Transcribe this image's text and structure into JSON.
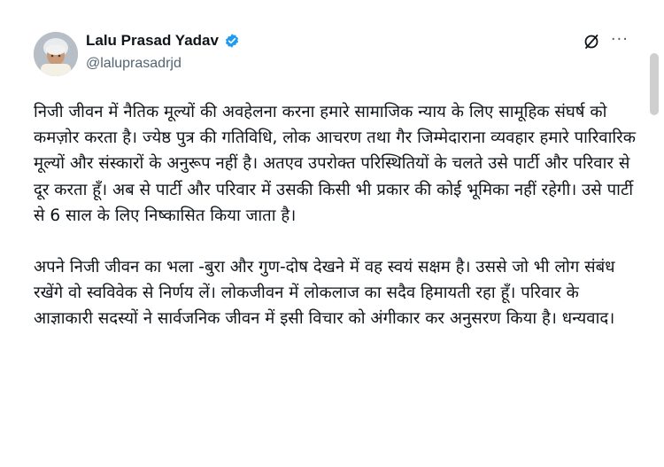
{
  "author": {
    "display_name": "Lalu Prasad Yadav",
    "handle": "@laluprasadrjd",
    "verified": true
  },
  "icons": {
    "verified": "verified-badge-icon",
    "grok": "grok-icon",
    "more": "more-options-icon"
  },
  "colors": {
    "text": "#0f1419",
    "secondary": "#536471",
    "verified_blue": "#1d9bf0"
  },
  "tweet": {
    "paragraphs": [
      "निजी जीवन में नैतिक मूल्यों की अवहेलना करना हमारे सामाजिक न्याय के लिए सामूहिक संघर्ष को कमज़ोर करता है। ज्येष्ठ पुत्र की गतिविधि, लोक आचरण तथा गैर जिम्मेदाराना व्यवहार हमारे पारिवारिक मूल्यों और संस्कारों के अनुरूप नहीं है। अतएव उपरोक्त परिस्थितियों के चलते उसे पार्टी और परिवार से दूर करता हूँ। अब से पार्टी और परिवार में उसकी किसी भी प्रकार की कोई भूमिका नहीं रहेगी। उसे पार्टी से 6 साल के लिए निष्कासित किया जाता है।",
      "अपने निजी जीवन का भला -बुरा और गुण-दोष देखने में वह स्वयं सक्षम है। उससे जो भी लोग संबंध रखेंगे वो स्वविवेक से निर्णय लें। लोकजीवन में लोकलाज का सदैव हिमायती रहा हूँ। परिवार के आज्ञाकारी सदस्यों ने सार्वजनिक जीवन में इसी विचार को अंगीकार कर अनुसरण किया है। धन्यवाद।"
    ]
  }
}
